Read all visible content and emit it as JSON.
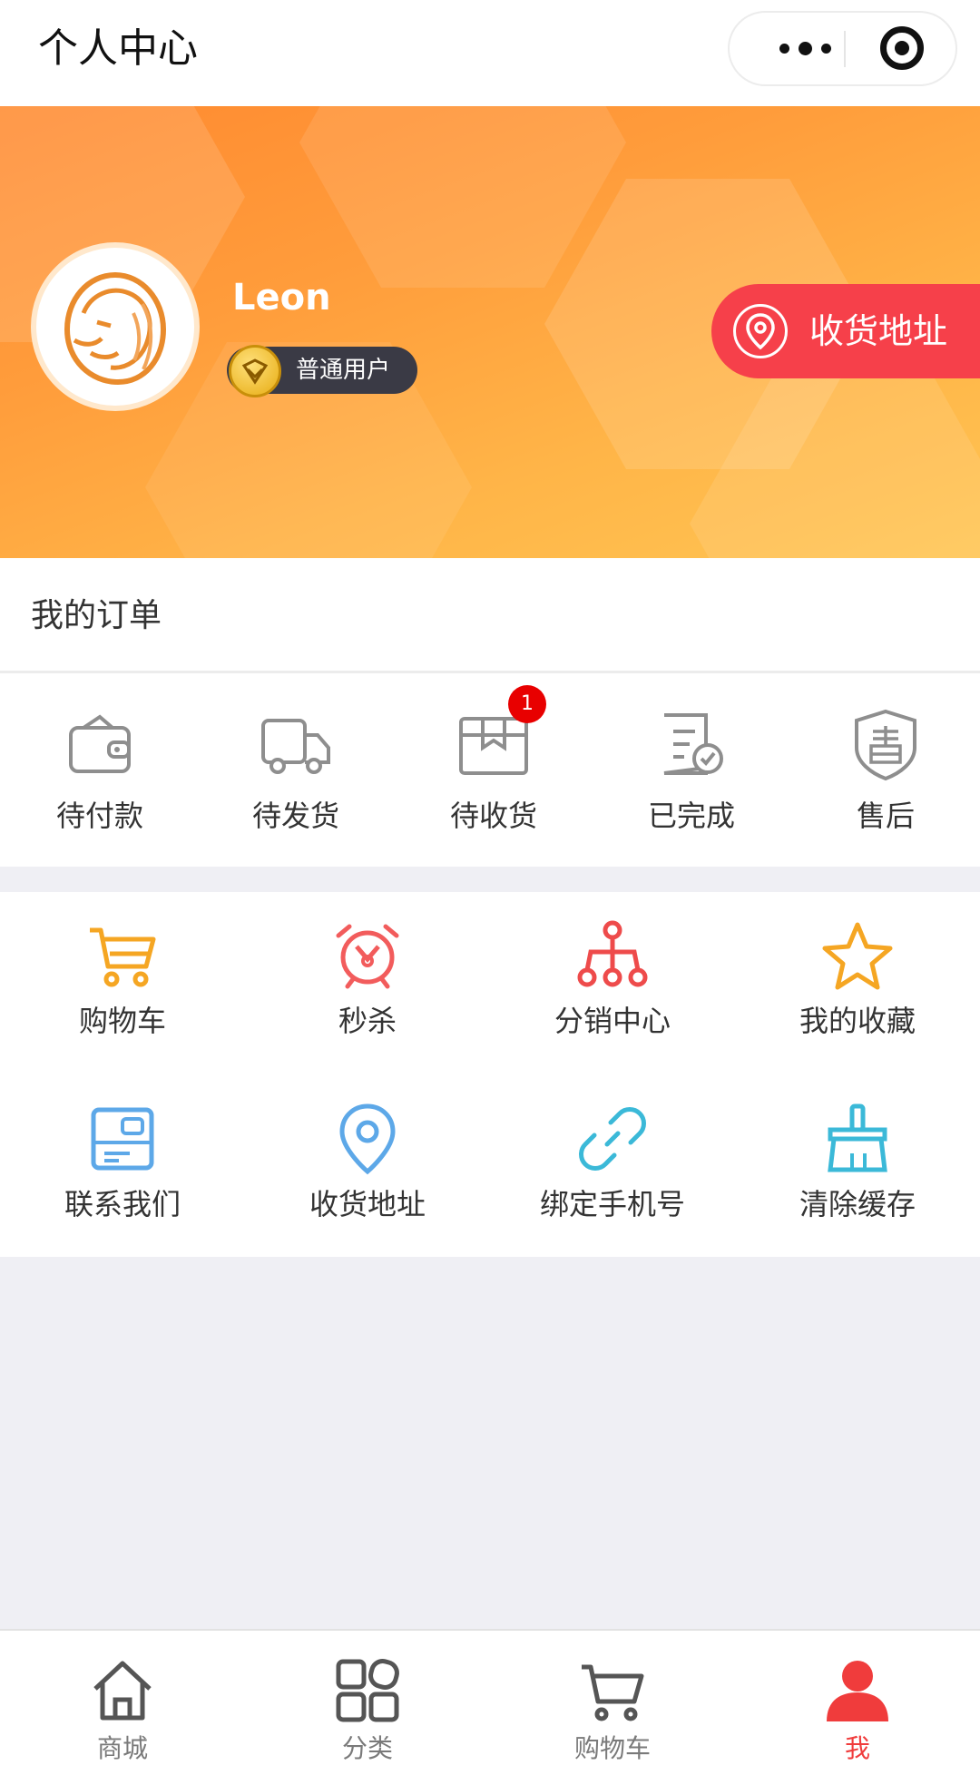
{
  "navbar": {
    "title": "个人中心"
  },
  "profile": {
    "username": "Leon",
    "level": "普通用户",
    "address_button": "收货地址"
  },
  "orders": {
    "title": "我的订单",
    "items": [
      {
        "label": "待付款",
        "icon": "wallet-icon"
      },
      {
        "label": "待发货",
        "icon": "truck-icon"
      },
      {
        "label": "待收货",
        "icon": "package-icon",
        "badge": "1"
      },
      {
        "label": "已完成",
        "icon": "document-check-icon"
      },
      {
        "label": "售后",
        "icon": "shield-after-sale-icon"
      }
    ]
  },
  "tools": {
    "items": [
      {
        "label": "购物车",
        "icon": "cart-icon",
        "color": "#f5a623"
      },
      {
        "label": "秒杀",
        "icon": "alarm-clock-icon",
        "color": "#f25c5c"
      },
      {
        "label": "分销中心",
        "icon": "hierarchy-icon",
        "color": "#ee4b4b"
      },
      {
        "label": "我的收藏",
        "icon": "star-icon",
        "color": "#f5a623"
      },
      {
        "label": "联系我们",
        "icon": "contact-card-icon",
        "color": "#5da8e8"
      },
      {
        "label": "收货地址",
        "icon": "location-pin-icon",
        "color": "#5da8e8"
      },
      {
        "label": "绑定手机号",
        "icon": "link-icon",
        "color": "#3bb9d8"
      },
      {
        "label": "清除缓存",
        "icon": "broom-icon",
        "color": "#3bb9d8"
      }
    ]
  },
  "tabbar": {
    "items": [
      {
        "label": "商城",
        "icon": "home-icon"
      },
      {
        "label": "分类",
        "icon": "category-grid-icon"
      },
      {
        "label": "购物车",
        "icon": "cart-icon"
      },
      {
        "label": "我",
        "icon": "person-icon",
        "active": true
      }
    ],
    "active_color": "#f03c3c",
    "inactive_color": "#7a7a7a"
  },
  "colors": {
    "accent_red": "#f6404a",
    "header_orange": "#ff9c3b",
    "badge_red": "#e80000"
  }
}
